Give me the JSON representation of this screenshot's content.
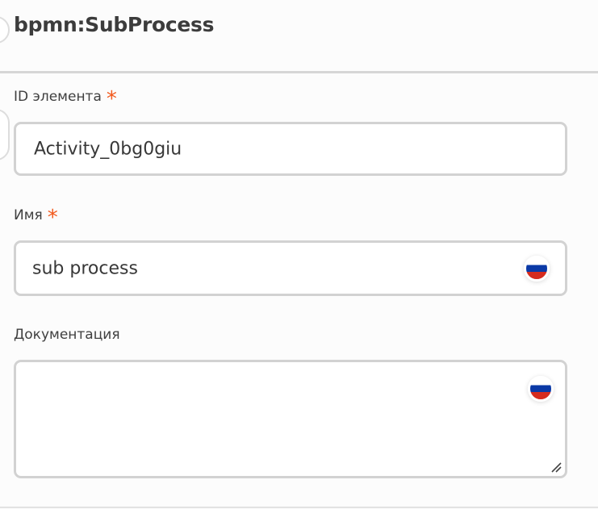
{
  "header": {
    "title": "bpmn:SubProcess"
  },
  "fields": {
    "id": {
      "label": "ID элемента",
      "required_mark": "*",
      "value": "Activity_0bg0giu"
    },
    "name": {
      "label": "Имя",
      "required_mark": "*",
      "value": "sub process",
      "locale_icon": "russia-flag-icon"
    },
    "documentation": {
      "label": "Документация",
      "value": "",
      "locale_icon": "russia-flag-icon"
    }
  },
  "colors": {
    "required": "#f25a1e",
    "border": "#d2d2d2"
  }
}
